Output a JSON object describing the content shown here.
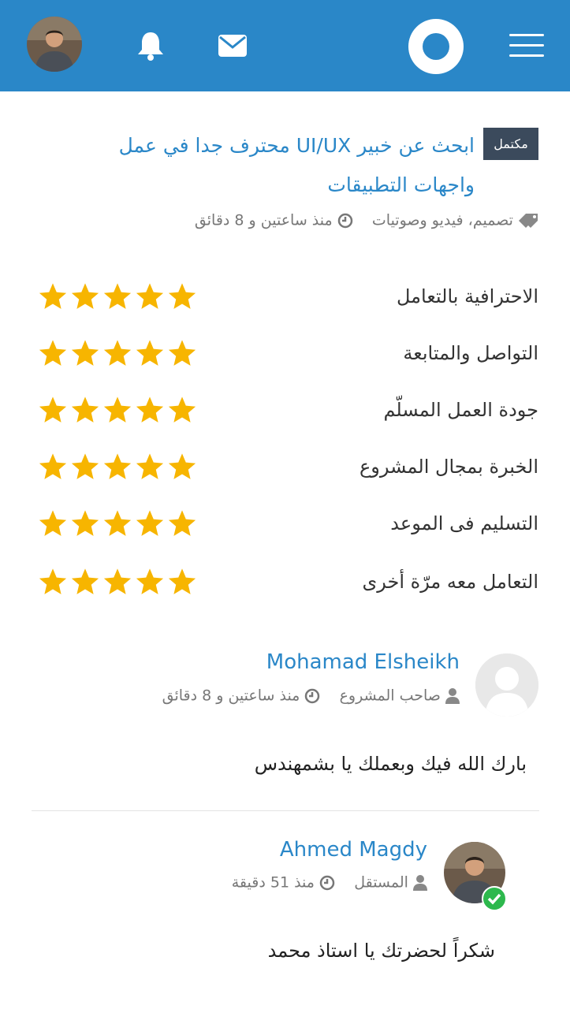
{
  "header": {
    "menu_icon": "hamburger-menu-icon",
    "logo_icon": "ring-logo-icon",
    "mail_icon": "envelope-icon",
    "bell_icon": "bell-icon",
    "brand_color": "#2a87c8"
  },
  "project": {
    "status_badge": "مكتمل",
    "title": "ابحث عن خبير UI/UX محترف جدا في عمل واجهات التطبيقات",
    "tags": "تصميم، فيديو وصوتيات",
    "time": "منذ ساعتين و 8 دقائق"
  },
  "ratings": [
    {
      "label": "الاحترافية بالتعامل",
      "stars": 5
    },
    {
      "label": "التواصل والمتابعة",
      "stars": 5
    },
    {
      "label": "جودة العمل المسلّم",
      "stars": 5
    },
    {
      "label": "الخبرة بمجال المشروع",
      "stars": 5
    },
    {
      "label": "التسليم فى الموعد",
      "stars": 5
    },
    {
      "label": "التعامل معه مرّة أخرى",
      "stars": 5
    }
  ],
  "star_color": "#f7b500",
  "comments": [
    {
      "name": "Mohamad Elsheikh",
      "role": "صاحب المشروع",
      "time": "منذ ساعتين و 8 دقائق",
      "text": "بارك الله فيك وبعملك يا بشمهندس"
    },
    {
      "name": "Ahmed Magdy",
      "role": "المستقل",
      "time": "منذ 51 دقيقة",
      "text": "شكراً لحضرتك يا استاذ محمد"
    }
  ]
}
